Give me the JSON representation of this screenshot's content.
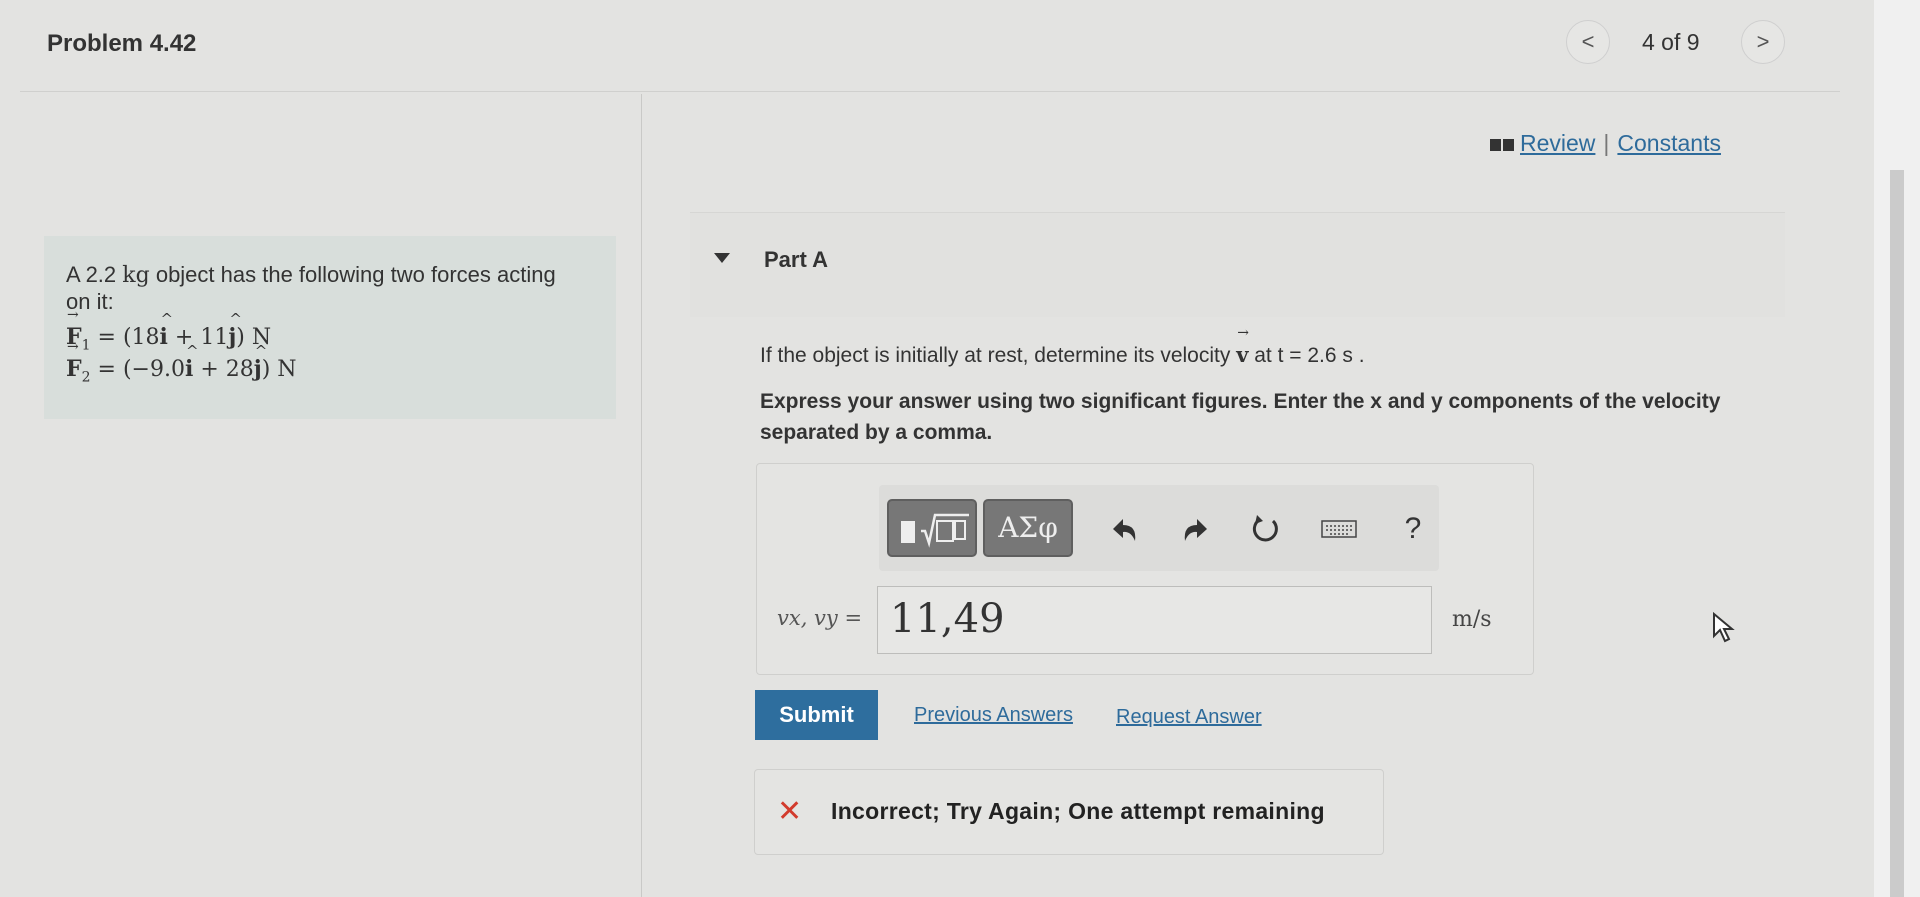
{
  "header": {
    "problem_title": "Problem 4.42",
    "page_counter": "4 of 9",
    "prev_glyph": "<",
    "next_glyph": ">"
  },
  "resources": {
    "review_label": "Review",
    "separator": "|",
    "constants_label": "Constants"
  },
  "problem": {
    "statement_prefix": "A 2.2",
    "statement_unit": "kg",
    "statement_suffix": "object has the following two forces acting on it:",
    "force1": {
      "symbol": "F",
      "sub": "1",
      "expr": " = (18",
      "mid": " + 11",
      "end": ") N"
    },
    "force2": {
      "symbol": "F",
      "sub": "2",
      "expr": " = (−9.0",
      "mid": " + 28",
      "end": ") N"
    }
  },
  "part": {
    "title": "Part A",
    "question_prefix": "If the object is initially at rest, determine its velocity ",
    "question_vec": "v",
    "question_suffix": " at t = 2.6 s .",
    "instructions": "Express your answer using two significant figures. Enter the x and y components of the velocity separated by a comma."
  },
  "answer": {
    "variable_label": "vx, vy =",
    "value": "11,49",
    "unit": "m/s",
    "symbols_label": "ΑΣφ",
    "help_label": "?"
  },
  "actions": {
    "submit_label": "Submit",
    "previous_answers_label": "Previous Answers",
    "request_answer_label": "Request Answer"
  },
  "feedback": {
    "status_icon": "✕",
    "message": "Incorrect; Try Again; One attempt remaining"
  },
  "colors": {
    "accent": "#2e6e9e",
    "error": "#d23b2d"
  }
}
